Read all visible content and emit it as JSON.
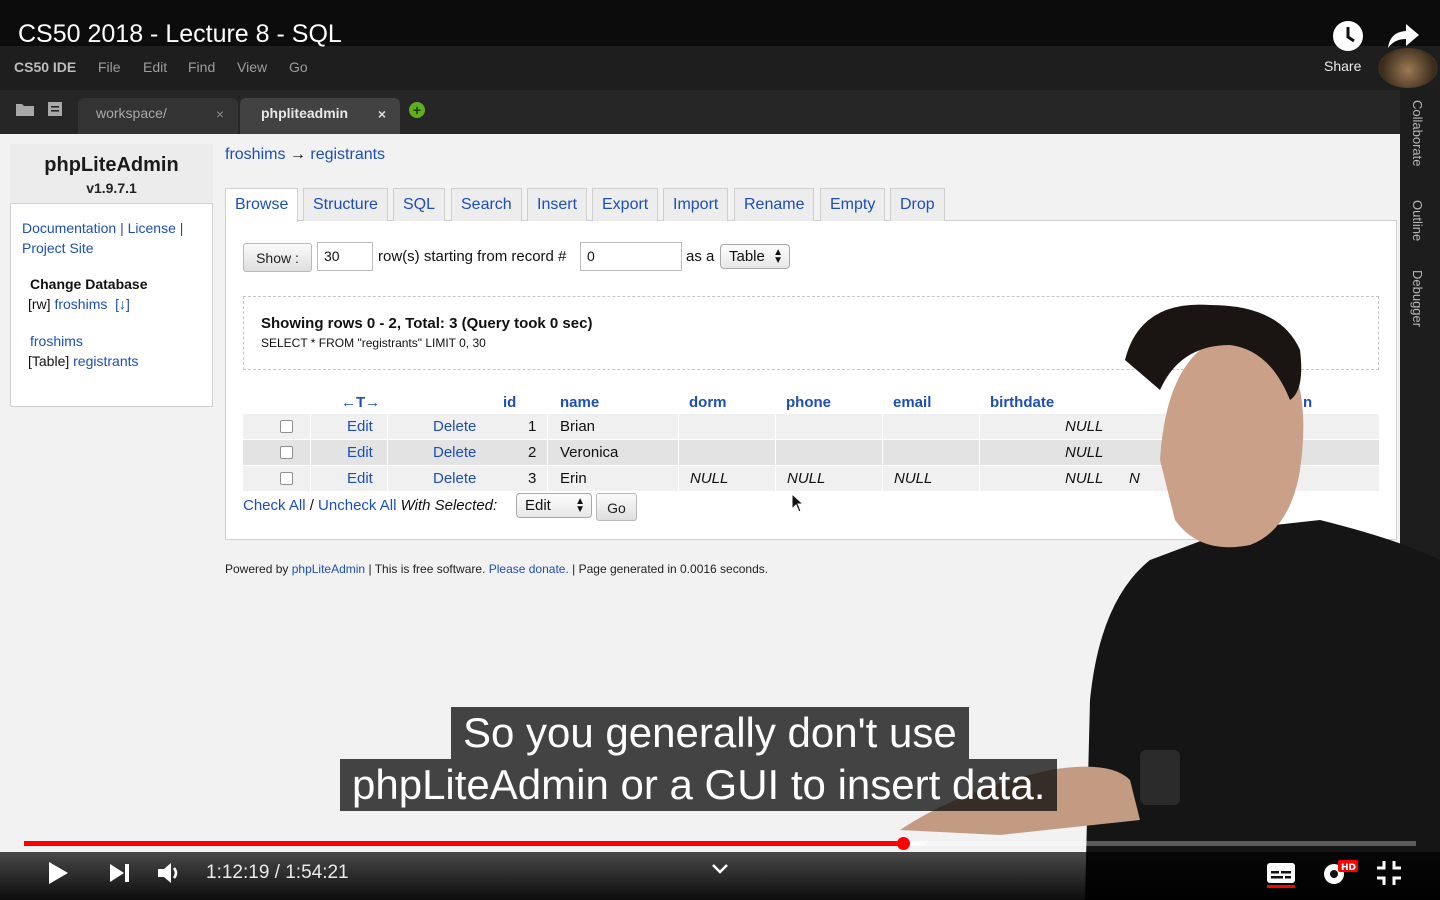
{
  "youtube": {
    "video_title": "CS50 2018 - Lecture 8 - SQL",
    "share_label": "Share",
    "time_display": "1:12:19 / 1:54:21",
    "progress_fraction": 0.6318,
    "buffered_fraction": 0.6477,
    "caption_lines": [
      "So you generally don't use",
      "phpLiteAdmin or a GUI to insert data."
    ]
  },
  "ide": {
    "brand": "CS50 IDE",
    "menu": [
      "File",
      "Edit",
      "Find",
      "View",
      "Go"
    ],
    "tabs": [
      {
        "label": "workspace/",
        "close": "×"
      },
      {
        "label": "phpliteadmin",
        "close": "×"
      }
    ],
    "add_tab": "+",
    "right_panel": [
      "Collaborate",
      "Outline",
      "Debugger"
    ]
  },
  "sidebar": {
    "title": "phpLiteAdmin",
    "version": "v1.9.7.1",
    "links": [
      "Documentation",
      "License",
      "Project Site"
    ],
    "separator": "|",
    "change_database": "Change Database",
    "db_mode": "[rw]",
    "db_name": "froshims",
    "db_download": "[↓]",
    "tree_db": "froshims",
    "tree_table_prefix": "[Table]",
    "tree_table": "registrants"
  },
  "breadcrumb": {
    "db": "froshims",
    "arrow": "→",
    "table": "registrants"
  },
  "action_tabs": [
    "Browse",
    "Structure",
    "SQL",
    "Search",
    "Insert",
    "Export",
    "Import",
    "Rename",
    "Empty",
    "Drop"
  ],
  "browse": {
    "show_button": "Show :",
    "rows_value": "30",
    "rows_text": "row(s) starting from record #",
    "start_value": "0",
    "as_a": "as a",
    "view_select": "Table"
  },
  "query": {
    "summary": "Showing rows 0 - 2, Total: 3 (Query took 0 sec)",
    "sql": "SELECT * FROM \"registrants\" LIMIT 0, 30"
  },
  "table": {
    "sort_header": "←T→",
    "columns": [
      "id",
      "name",
      "dorm",
      "phone",
      "email",
      "birthdate",
      "n"
    ],
    "edit_label": "Edit",
    "delete_label": "Delete",
    "rows": [
      {
        "id": "1",
        "name": "Brian",
        "dorm": "",
        "phone": "",
        "email": "",
        "birthdate": "NULL",
        "extra": ""
      },
      {
        "id": "2",
        "name": "Veronica",
        "dorm": "",
        "phone": "",
        "email": "",
        "birthdate": "NULL",
        "extra": ""
      },
      {
        "id": "3",
        "name": "Erin",
        "dorm": "NULL",
        "phone": "NULL",
        "email": "NULL",
        "birthdate": "NULL",
        "extra": "N"
      }
    ]
  },
  "bulk": {
    "check_all": "Check All",
    "slash": "/",
    "uncheck_all": "Uncheck All",
    "with_selected": "With Selected:",
    "action_select": "Edit",
    "go_button": "Go"
  },
  "footer": {
    "powered_by": "Powered by",
    "app_link": "phpLiteAdmin",
    "free_text": "| This is free software.",
    "donate_link": "Please donate.",
    "generated_text": "| Page generated in 0.0016 seconds."
  },
  "colors": {
    "link": "#1d4eb8",
    "progress": "#ff0000",
    "ide_dark": "#1e1e1e"
  }
}
